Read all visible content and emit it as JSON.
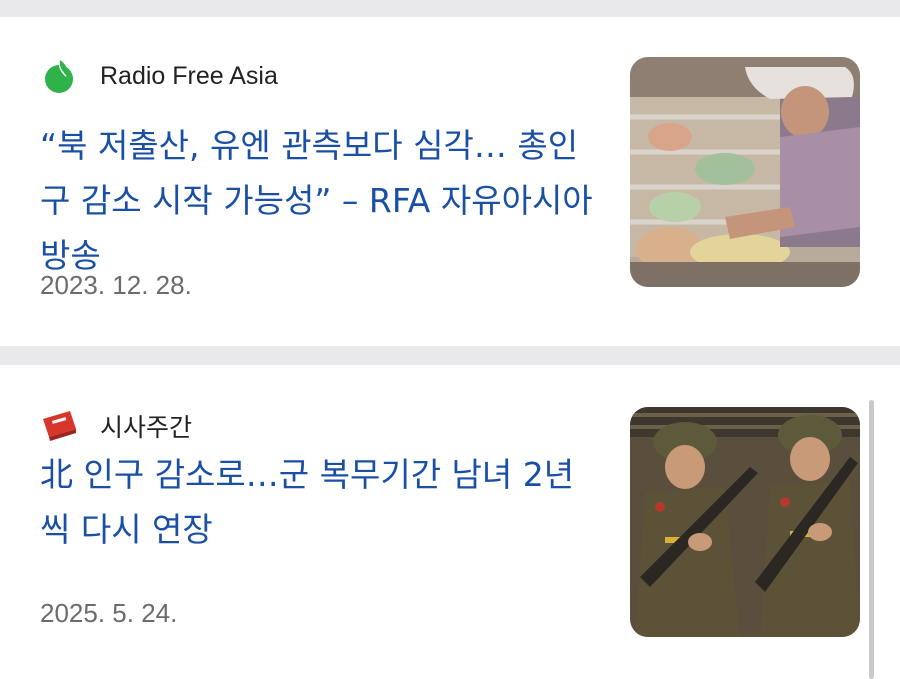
{
  "articles": [
    {
      "source": "Radio Free Asia",
      "source_icon": "rfa-green-leaf-logo-icon",
      "headline": "“북 저출산, 유엔 관측보다 심각… 총인구 감소 시작 가능성” – RFA 자유아시아방송",
      "date": "2023. 12. 28.",
      "thumbnail": "nursery-infants-photo"
    },
    {
      "source": "시사주간",
      "source_icon": "sisajugan-red-logo-icon",
      "headline": "北 인구 감소로…군 복무기간 남녀 2년씩 다시 연장",
      "date": "2025. 5. 24.",
      "thumbnail": "soldiers-parade-photo"
    }
  ],
  "colors": {
    "headline": "#1a4fa6",
    "date": "#6b6b6b",
    "background": "#e9e9ec",
    "rfa_logo": "#2fb24a",
    "sisajugan_logo": "#d8362b"
  }
}
